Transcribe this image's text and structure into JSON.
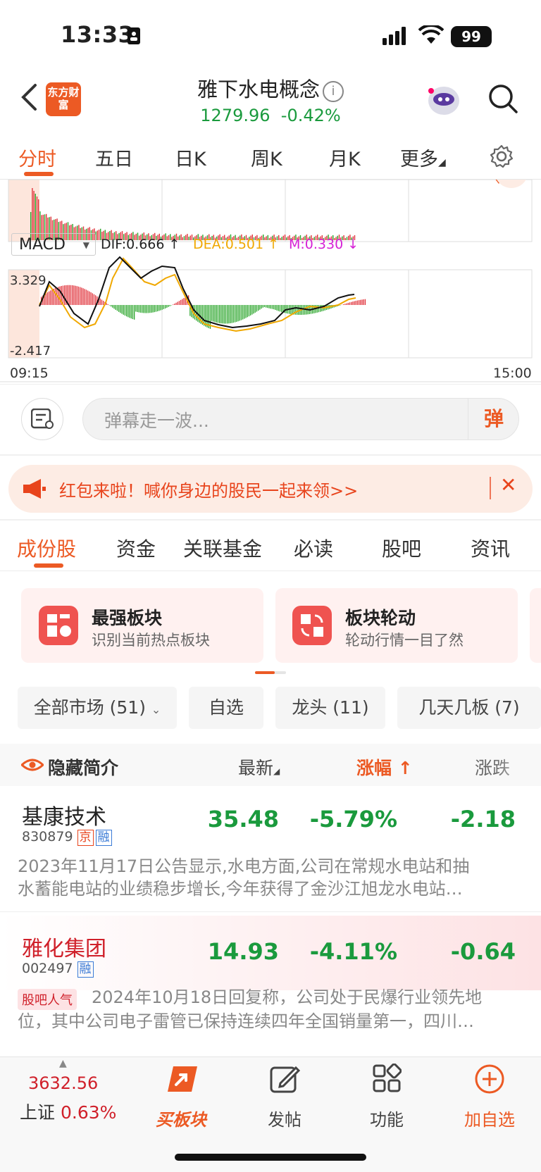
{
  "status": {
    "time": "13:33",
    "battery": "99"
  },
  "header": {
    "title": "雅下水电概念",
    "price": "1279.96",
    "change": "-0.42%",
    "logo_text": "东方财富"
  },
  "chart_tabs": [
    "分时",
    "五日",
    "日K",
    "周K",
    "月K",
    "更多"
  ],
  "macd": {
    "select": "MACD",
    "dif": "DIF:0.666 ↑",
    "dea": "DEA:0.501 ↑",
    "m": "M:0.330 ↓",
    "ymax": "3.329",
    "ymin": "-2.417",
    "t_start": "09:15",
    "t_end": "15:00"
  },
  "danmu": {
    "placeholder": "弹幕走一波...",
    "button": "弹"
  },
  "promo": {
    "text": "红包来啦！喊你身边的股民一起来领>>",
    "close": "✕"
  },
  "content_tabs": [
    "成份股",
    "资金",
    "关联基金",
    "必读",
    "股吧",
    "资讯"
  ],
  "cards": [
    {
      "title": "最强板块",
      "sub": "识别当前热点板块"
    },
    {
      "title": "板块轮动",
      "sub": "轮动行情一目了然"
    }
  ],
  "filters": [
    "全部市场 (51)",
    "自选",
    "龙头 (11)",
    "几天几板 (7)"
  ],
  "table_head": {
    "hide": "隐藏简介",
    "latest": "最新",
    "pct": "涨幅",
    "chg": "涨跌"
  },
  "rows": [
    {
      "name": "基康技术",
      "code": "830879",
      "badges": [
        "京",
        "融"
      ],
      "latest": "35.48",
      "pct": "-5.79%",
      "chg": "-2.18",
      "desc1": "2023年11月17日公告显示,水电方面,公司在常规水电站和抽",
      "desc2": "水蓄能电站的业绩稳步增长,今年获得了金沙江旭龙水电站…"
    },
    {
      "name": "雅化集团",
      "code": "002497",
      "badges": [
        "融"
      ],
      "latest": "14.93",
      "pct": "-4.11%",
      "chg": "-0.64",
      "tag": "股吧人气",
      "desc1": "2024年10月18日回复称，公司处于民爆行业领先地",
      "desc2": "位，其中公司电子雷管已保持连续四年全国销量第一，四川…"
    }
  ],
  "bottom": {
    "index_value": "3632.56",
    "index_name": "上证",
    "index_pct": "0.63%",
    "buy": "买板块",
    "post": "发帖",
    "func": "功能",
    "add": "加自选"
  }
}
